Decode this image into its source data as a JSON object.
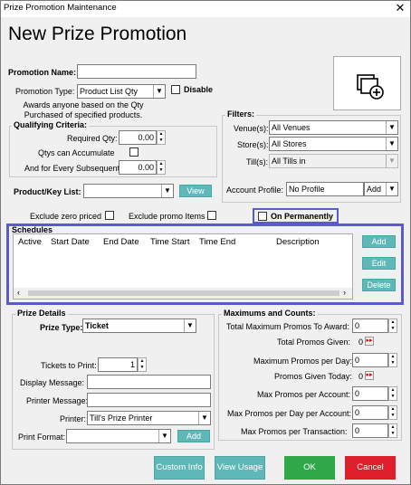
{
  "window": {
    "title": "Prize Promotion Maintenance",
    "close": "✕"
  },
  "heading": "New Prize Promotion",
  "promotion_name": {
    "label": "Promotion Name:",
    "value": ""
  },
  "promotion_type": {
    "label": "Promotion Type:",
    "value": "Product List Qty",
    "disable_label": "Disable"
  },
  "description": "Awards anyone based on the Qty Purchased of specified products.",
  "qualifying": {
    "title": "Qualifying Criteria:",
    "required_qty_label": "Required Qty:",
    "required_qty": "0.00",
    "qtys_accumulate_label": "Qtys can Accumulate",
    "subsequent_label": "And for Every Subsequent",
    "subsequent": "0.00"
  },
  "product_list": {
    "label": "Product/Key List:",
    "value": "",
    "view_button": "View"
  },
  "exclude_zero": "Exclude zero priced",
  "exclude_promo": "Exclude promo Items",
  "on_permanently": "On Permanently",
  "filters": {
    "title": "Filters:",
    "venue_label": "Venue(s):",
    "venue": "All Venues",
    "store_label": "Store(s):",
    "store": "All Stores",
    "till_label": "Till(s):",
    "till": "All Tills in",
    "profile_label": "Account Profile:",
    "profile": "No Profile",
    "add": "Add"
  },
  "schedules": {
    "title": "Schedules",
    "columns": [
      "Active",
      "Start Date",
      "End Date",
      "Time Start",
      "Time End",
      "Description"
    ],
    "add": "Add",
    "edit": "Edit",
    "delete": "Delete"
  },
  "prize": {
    "title": "Prize Details",
    "type_label": "Prize Type:",
    "type": "Ticket",
    "tickets_label": "Tickets to Print:",
    "tickets": "1",
    "display_label": "Display Message:",
    "display": "",
    "printer_msg_label": "Printer Message:",
    "printer_msg": "",
    "printer_label": "Printer:",
    "printer": "Till's Prize Printer",
    "format_label": "Print Format:",
    "format": "",
    "add": "Add"
  },
  "maximums": {
    "title": "Maximums and Counts:",
    "total_max_label": "Total Maximum Promos To Award:",
    "total_max": "0",
    "total_given_label": "Total Promos Given:",
    "total_given": "0",
    "max_day_label": "Maximum Promos per Day:",
    "max_day": "0",
    "given_today_label": "Promos Given Today:",
    "given_today": "0",
    "max_account_label": "Max Promos per Account:",
    "max_account": "0",
    "max_day_account_label": "Max Promos per Day per Account:",
    "max_day_account": "0",
    "max_transaction_label": "Max Promos per Transaction:",
    "max_transaction": "0"
  },
  "buttons": {
    "custom_info": "Custom Info",
    "view_usage": "View Usage",
    "ok": "OK",
    "cancel": "Cancel"
  },
  "icons": {
    "add_promo": "add-promotion-icon",
    "go": "arrow-right-icon"
  },
  "colors": {
    "teal": "#5fb8b8",
    "ok": "#2fa84a",
    "cancel": "#dc1f2a",
    "highlight": "#5a5ac8"
  }
}
